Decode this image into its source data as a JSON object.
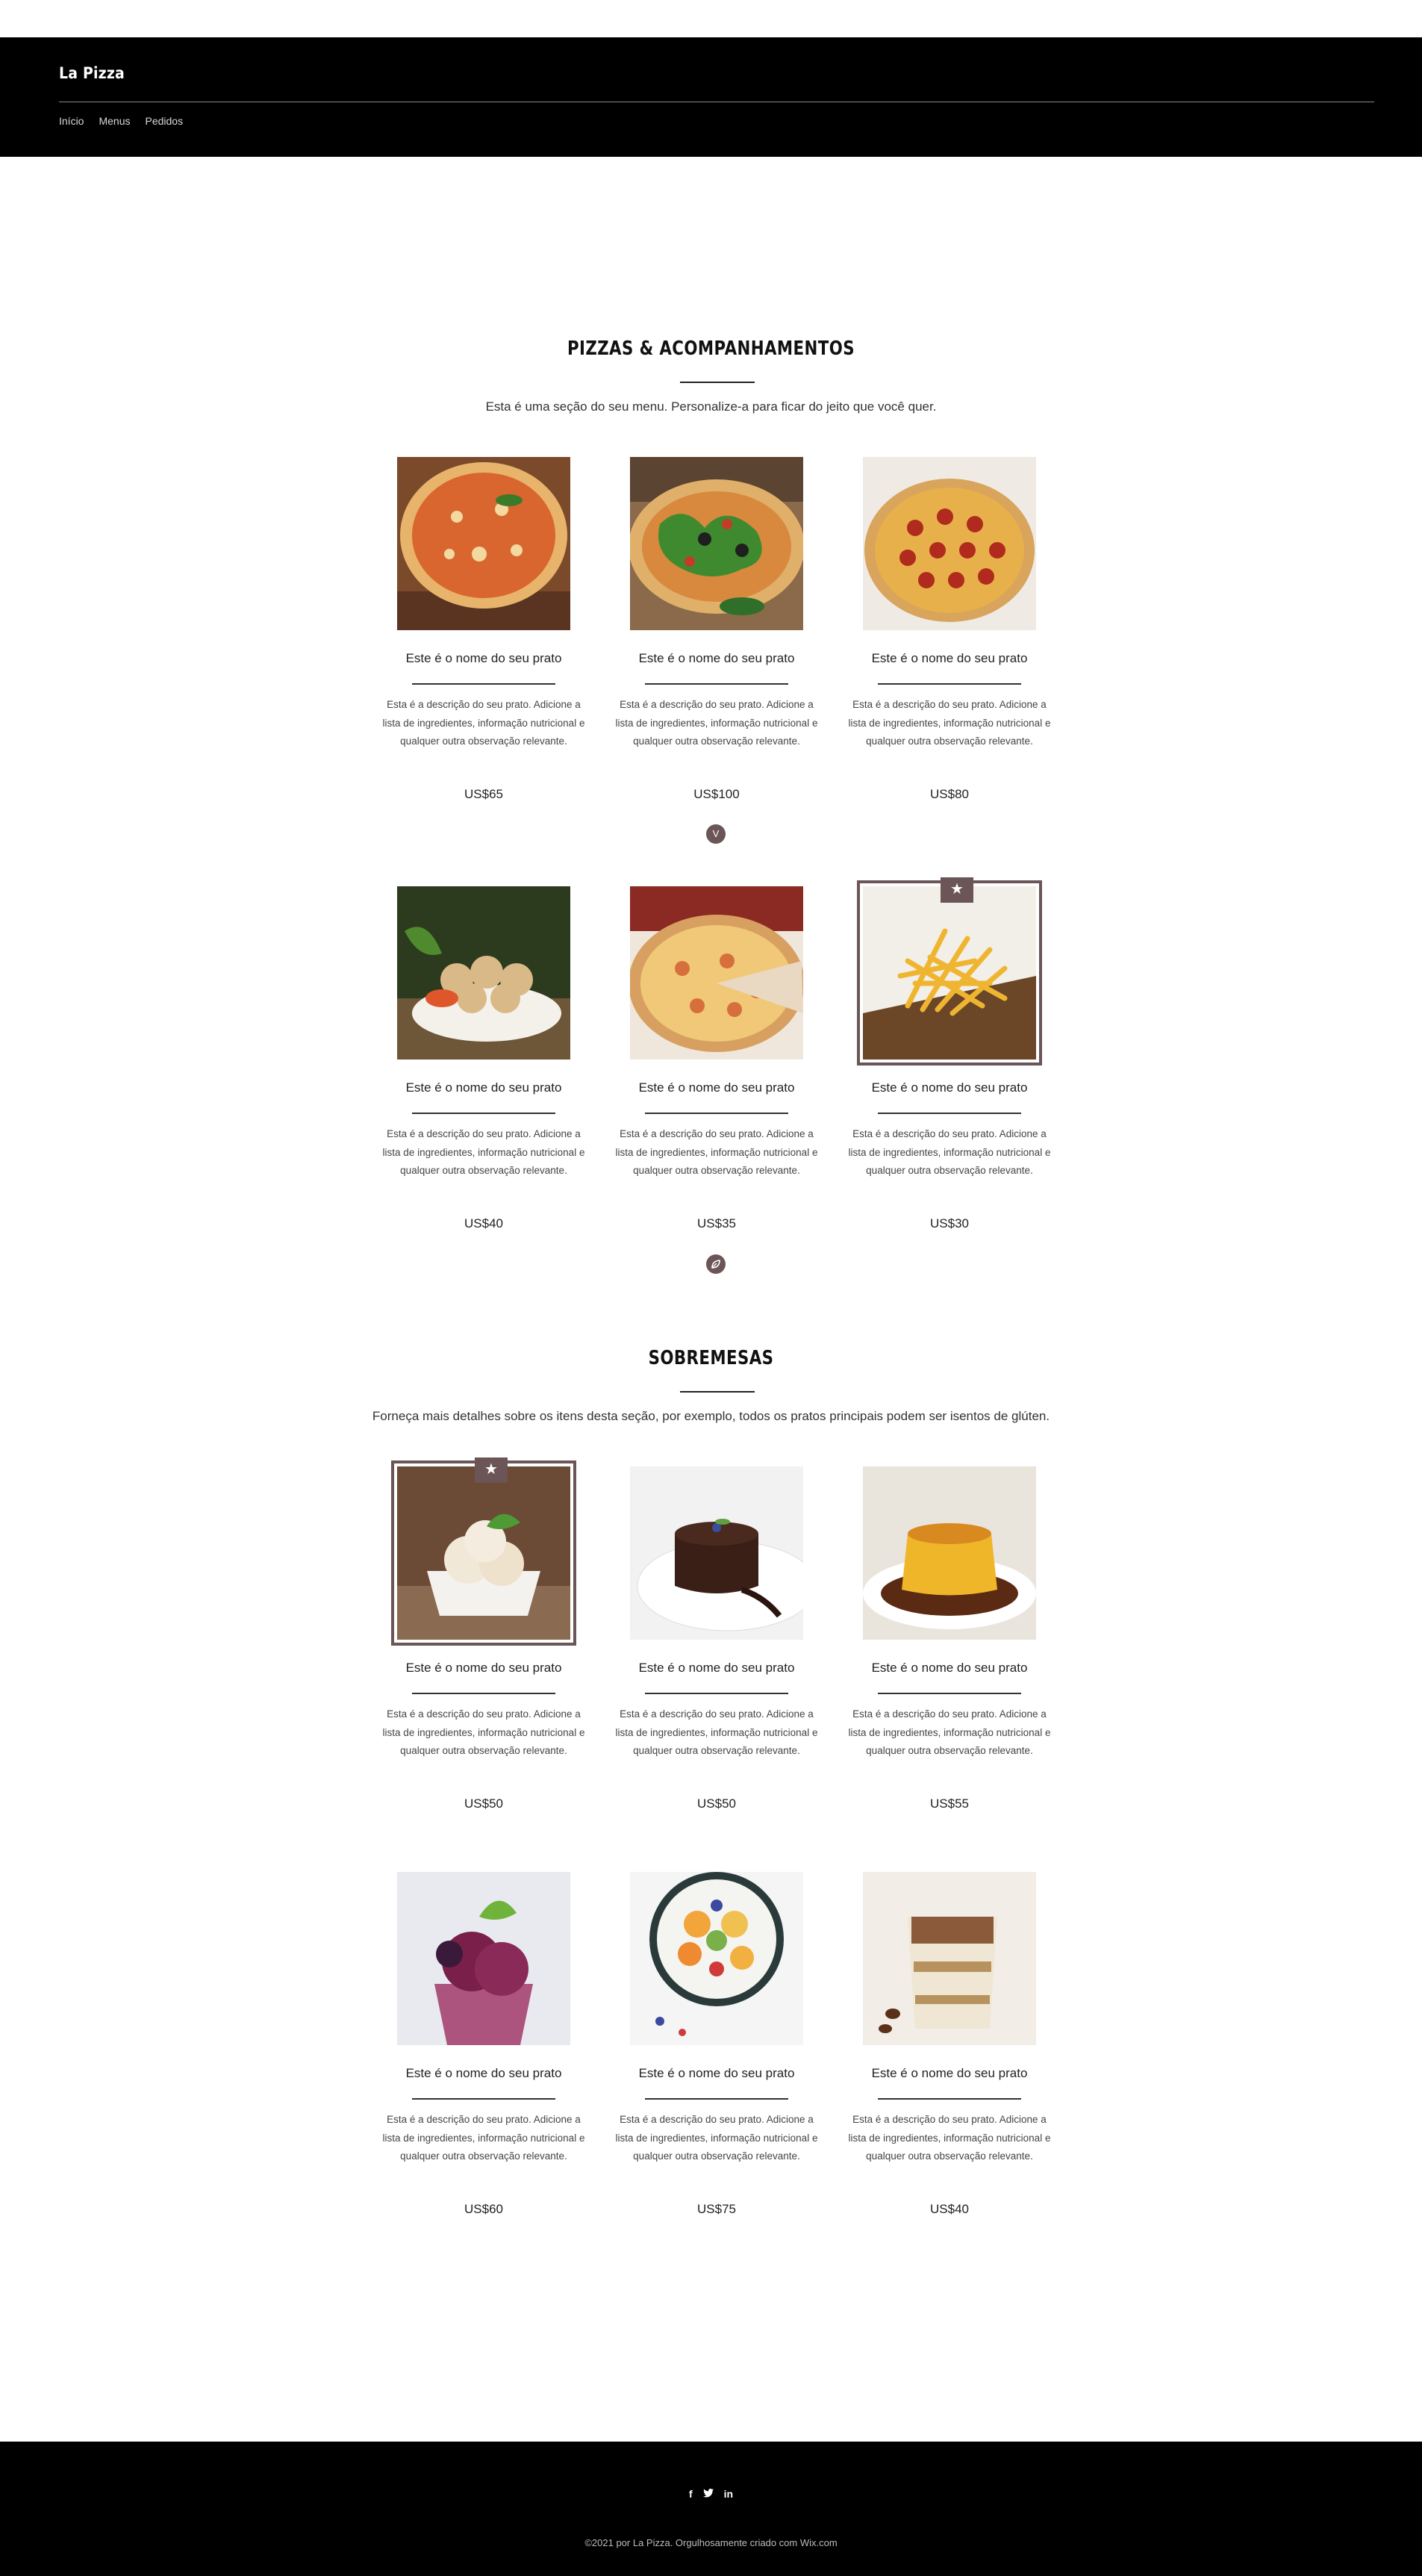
{
  "header": {
    "site_title": "La Pizza",
    "nav": [
      "Início",
      "Menus",
      "Pedidos"
    ]
  },
  "sections": [
    {
      "title": "PIZZAS & ACOMPANHAMENTOS",
      "description": "Esta é uma seção do seu menu. Personalize-a para ficar do jeito que você quer.",
      "items": [
        {
          "name": "Este é o nome do seu prato",
          "description": "Esta é a descrição do seu prato. Adicione a lista de ingredientes, informação nutricional e qualquer outra observação relevante.",
          "price": "US$65",
          "image": "pizza-margherita"
        },
        {
          "name": "Este é o nome do seu prato",
          "description": "Esta é a descrição do seu prato. Adicione a lista de ingredientes, informação nutricional e qualquer outra observação relevante.",
          "price": "US$100",
          "image": "pizza-arugula"
        },
        {
          "name": "Este é o nome do seu prato",
          "description": "Esta é a descrição do seu prato. Adicione a lista de ingredientes, informação nutricional e qualquer outra observação relevante.",
          "price": "US$80",
          "image": "pizza-pepperoni"
        },
        {
          "name": "Este é o nome do seu prato",
          "description": "Esta é a descrição do seu prato. Adicione a lista de ingredientes, informação nutricional e qualquer outra observação relevante.",
          "price": "US$40",
          "image": "garlic-bread-bowl"
        },
        {
          "name": "Este é o nome do seu prato",
          "description": "Esta é a descrição do seu prato. Adicione a lista de ingredientes, informação nutricional e qualquer outra observação relevante.",
          "price": "US$35",
          "image": "pizza-cheese"
        },
        {
          "name": "Este é o nome do seu prato",
          "description": "Esta é a descrição do seu prato. Adicione a lista de ingredientes, informação nutricional e qualquer outra observação relevante.",
          "price": "US$30",
          "image": "french-fries",
          "featured": true
        }
      ],
      "badges": [
        "V",
        "leaf-icon"
      ]
    },
    {
      "title": "SOBREMESAS",
      "description": "Forneça mais detalhes sobre os itens desta seção, por exemplo, todos os pratos principais podem ser isentos de glúten.",
      "items": [
        {
          "name": "Este é o nome do seu prato",
          "description": "Esta é a descrição do seu prato. Adicione a lista de ingredientes, informação nutricional e qualquer outra observação relevante.",
          "price": "US$50",
          "image": "ice-cream",
          "featured": true
        },
        {
          "name": "Este é o nome do seu prato",
          "description": "Esta é a descrição do seu prato. Adicione a lista de ingredientes, informação nutricional e qualquer outra observação relevante.",
          "price": "US$50",
          "image": "lava-cake"
        },
        {
          "name": "Este é o nome do seu prato",
          "description": "Esta é a descrição do seu prato. Adicione a lista de ingredientes, informação nutricional e qualquer outra observação relevante.",
          "price": "US$55",
          "image": "flan"
        },
        {
          "name": "Este é o nome do seu prato",
          "description": "Esta é a descrição do seu prato. Adicione a lista de ingredientes, informação nutricional e qualquer outra observação relevante.",
          "price": "US$60",
          "image": "berry-sorbet"
        },
        {
          "name": "Este é o nome do seu prato",
          "description": "Esta é a descrição do seu prato. Adicione a lista de ingredientes, informação nutricional e qualquer outra observação relevante.",
          "price": "US$75",
          "image": "fruit-plate"
        },
        {
          "name": "Este é o nome do seu prato",
          "description": "Esta é a descrição do seu prato. Adicione a lista de ingredientes, informação nutricional e qualquer outra observação relevante.",
          "price": "US$40",
          "image": "tiramisu"
        }
      ]
    }
  ],
  "footer": {
    "social": [
      "f",
      "t",
      "in"
    ],
    "social_icons": [
      "facebook-icon",
      "twitter-icon",
      "linkedin-icon"
    ],
    "copyright": "©2021 por La Pizza. Orgulhosamente criado com Wix.com"
  },
  "colors": {
    "header_bg": "#000000",
    "accent": "#6b5556",
    "page_bg": "#ffffff"
  }
}
